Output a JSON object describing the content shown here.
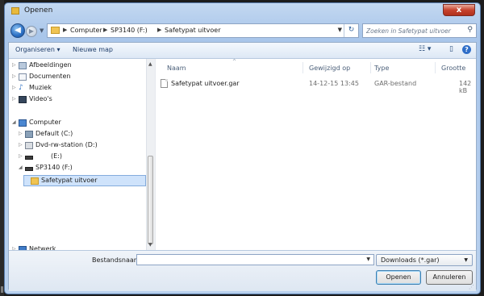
{
  "window": {
    "title": "Openen",
    "close_glyph": "x"
  },
  "nav": {
    "back_glyph": "◀",
    "forward_glyph": "▶",
    "breadcrumbs": [
      "Computer",
      "SP3140 (F:)",
      "Safetypat uitvoer"
    ],
    "refresh_glyph": "↻",
    "search_placeholder": "Zoeken in Safetypat uitvoer"
  },
  "toolbar": {
    "organize_label": "Organiseren ▾",
    "new_folder_label": "Nieuwe map"
  },
  "sidebar": {
    "items": [
      {
        "label": "Afbeeldingen",
        "icon": "pictures-icon"
      },
      {
        "label": "Documenten",
        "icon": "documents-icon"
      },
      {
        "label": "Muziek",
        "icon": "music-icon"
      },
      {
        "label": "Video's",
        "icon": "videos-icon"
      },
      {
        "label": "Computer",
        "icon": "computer-icon"
      },
      {
        "label": "Default (C:)",
        "icon": "drive-c-icon"
      },
      {
        "label": "Dvd-rw-station (D:)",
        "icon": "dvd-drive-icon"
      },
      {
        "label": "(E:)",
        "icon": "drive-icon"
      },
      {
        "label": "SP3140 (F:)",
        "icon": "usb-drive-icon"
      },
      {
        "label": "Safetypat uitvoer",
        "icon": "folder-icon"
      },
      {
        "label": "Netwerk",
        "icon": "network-icon"
      }
    ]
  },
  "columns": {
    "name": "Naam",
    "modified": "Gewijzigd op",
    "type": "Type",
    "size": "Grootte"
  },
  "files": [
    {
      "name": "Safetypat uitvoer.gar",
      "modified": "14-12-15 13:45",
      "type": "GAR-bestand",
      "size": "142 kB"
    }
  ],
  "footer": {
    "filename_label": "Bestandsnaam:",
    "filename_value": "",
    "filter_value": "Downloads (*.gar)",
    "open_label": "Openen",
    "cancel_label": "Annuleren"
  },
  "colors": {
    "selection": "#cfe3fb",
    "title_close": "#c7432e",
    "folder": "#f0c453"
  }
}
